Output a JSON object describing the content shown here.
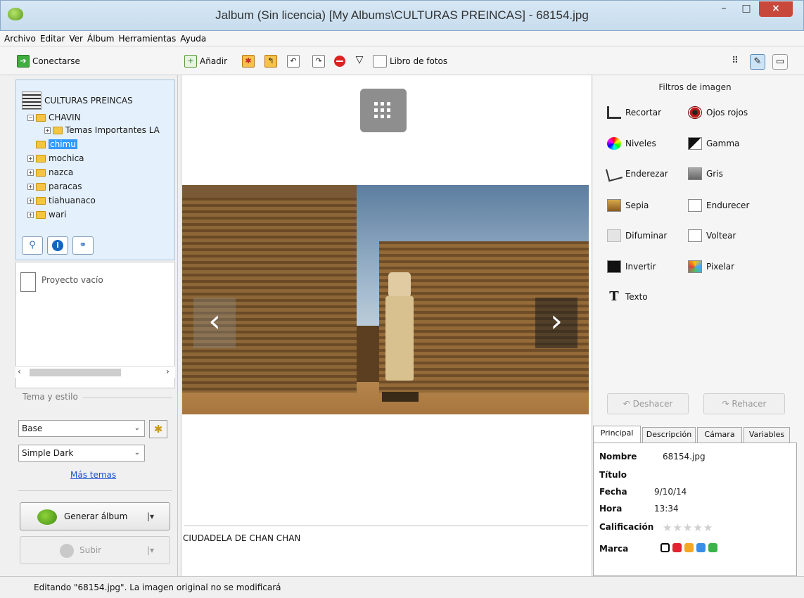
{
  "window": {
    "title": "Jalbum (Sin licencia) [My Albums\\CULTURAS PREINCAS] - 68154.jpg",
    "minimize_glyph": "–",
    "maximize_glyph": "□",
    "close_glyph": "×"
  },
  "menu": [
    "Archivo",
    "Editar",
    "Ver",
    "Álbum",
    "Herramientas",
    "Ayuda"
  ],
  "toolbar": {
    "connect_label": "Conectarse",
    "add_label": "Añadir",
    "photobook_label": "Libro de fotos"
  },
  "tree": {
    "root": "CULTURAS PREINCAS",
    "items": [
      {
        "label": "CHAVIN",
        "expander": "−"
      },
      {
        "label": "Temas Importantes  LA",
        "expander": "+"
      },
      {
        "label": "chimu",
        "selected": true
      },
      {
        "label": "mochica",
        "expander": "+"
      },
      {
        "label": "nazca",
        "expander": "+"
      },
      {
        "label": "paracas",
        "expander": "+"
      },
      {
        "label": "tiahuanaco",
        "expander": "+"
      },
      {
        "label": "wari",
        "expander": "+"
      }
    ]
  },
  "project": {
    "empty_label": "Proyecto vacío"
  },
  "theme": {
    "section_label": "Tema y estilo",
    "skin": "Base",
    "style": "Simple Dark",
    "more_link": "Más temas",
    "generate_label": "Generar álbum",
    "upload_label": "Subir"
  },
  "viewer": {
    "caption": "CIUDADELA DE CHAN CHAN",
    "prev_glyph": "‹",
    "next_glyph": "›"
  },
  "filters": {
    "title": "Filtros de imagen",
    "items": [
      {
        "label": "Recortar",
        "icon": "crop-icon"
      },
      {
        "label": "Ojos rojos",
        "icon": "red-eye-icon"
      },
      {
        "label": "Niveles",
        "icon": "levels-icon"
      },
      {
        "label": "Gamma",
        "icon": "gamma-icon"
      },
      {
        "label": "Enderezar",
        "icon": "straighten-icon"
      },
      {
        "label": "Gris",
        "icon": "grayscale-icon"
      },
      {
        "label": "Sepia",
        "icon": "sepia-icon"
      },
      {
        "label": "Endurecer",
        "icon": "sharpen-icon"
      },
      {
        "label": "Difuminar",
        "icon": "blur-icon"
      },
      {
        "label": "Voltear",
        "icon": "flip-icon"
      },
      {
        "label": "Invertir",
        "icon": "invert-icon"
      },
      {
        "label": "Pixelar",
        "icon": "pixelate-icon"
      },
      {
        "label": "Texto",
        "icon": "text-icon"
      }
    ],
    "undo_label": "Deshacer",
    "redo_label": "Rehacer"
  },
  "props": {
    "tabs": [
      "Principal",
      "Descripción",
      "Cámara",
      "Variables"
    ],
    "rows": [
      {
        "key": "Nombre",
        "value": "68154.jpg"
      },
      {
        "key": "Título",
        "value": ""
      },
      {
        "key": "Fecha",
        "value": "9/10/14"
      },
      {
        "key": "Hora",
        "value": "13:34"
      },
      {
        "key": "Calificación",
        "value": ""
      },
      {
        "key": "Marca",
        "value": ""
      }
    ],
    "rating": 0,
    "rating_max": 5,
    "mark_colors": [
      "#e0232f",
      "#f5a623",
      "#3a8ee6",
      "#3cb34a"
    ]
  },
  "status": {
    "text": "Editando \"68154.jpg\". La imagen original no se modificará"
  }
}
